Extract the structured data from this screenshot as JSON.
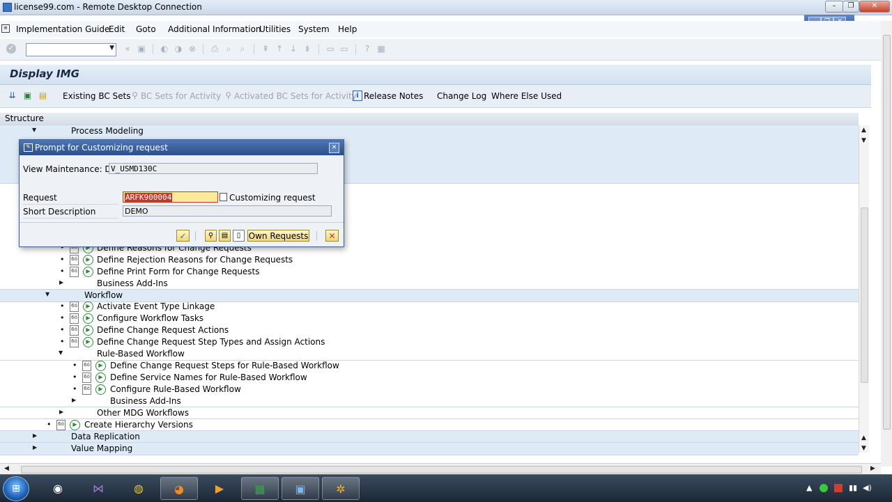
{
  "window": {
    "title": "license99.com - Remote Desktop Connection",
    "buttons": {
      "minimize": "–",
      "restore": "❐",
      "close": "✕"
    }
  },
  "menubar": {
    "items": [
      "Implementation Guide",
      "Edit",
      "Goto",
      "Additional Information",
      "Utilities",
      "System",
      "Help"
    ]
  },
  "page": {
    "title": "Display IMG"
  },
  "app_toolbar": {
    "existing_bc_sets": "Existing BC Sets",
    "bc_sets_for_activity": "BC Sets for Activity",
    "activated_bc_sets": "Activated BC Sets for Activity",
    "release_notes": "Release Notes",
    "change_log": "Change Log",
    "where_else_used": "Where Else Used"
  },
  "structure": {
    "header": "Structure",
    "rows": [
      "Process Modeling",
      "Define Reasons for Change Requests",
      "Define Rejection Reasons for Change Requests",
      "Define Print Form for Change Requests",
      "Business Add-Ins",
      "Workflow",
      "Activate Event Type Linkage",
      "Configure Workflow Tasks",
      "Define Change Request Actions",
      "Define Change Request Step Types and Assign Actions",
      "Rule-Based Workflow",
      "Define Change Request Steps for Rule-Based Workflow",
      "Define Service Names for Rule-Based Workflow",
      "Configure Rule-Based Workflow",
      "Business Add-Ins",
      "Other MDG Workflows",
      "Create Hierarchy Versions",
      "Data Replication",
      "Value Mapping"
    ]
  },
  "dialog": {
    "title": "Prompt for Customizing request",
    "view_label": "View Maintenance: D...",
    "view_value": "V_USMD130C",
    "request_label": "Request",
    "request_value": "ARFK900004",
    "request_hint": "Customizing request",
    "short_desc_label": "Short Description",
    "short_desc_value": "DEMO",
    "own_requests": "Own Requests"
  },
  "colors": {
    "dialog_header": "#2c4f8c",
    "band": "#dfeaf7",
    "required_field": "#fde99a"
  }
}
